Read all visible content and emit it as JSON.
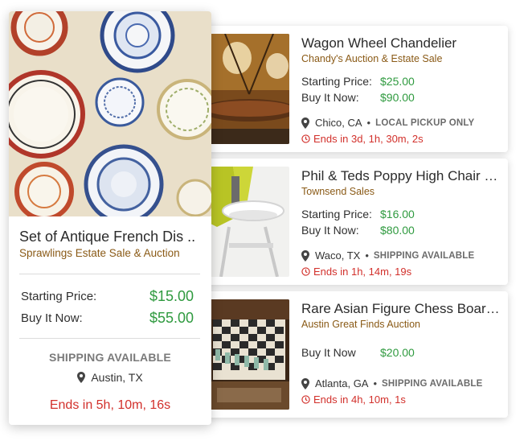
{
  "featured": {
    "title": "Set of Antique French Dis ..",
    "seller": "Sprawlings Estate Sale & Auction",
    "starting_label": "Starting Price:",
    "starting_price": "$15.00",
    "buy_label": "Buy It Now:",
    "buy_price": "$55.00",
    "shipping": "SHIPPING AVAILABLE",
    "location": "Austin, TX",
    "ends": "Ends in 5h, 10m, 16s",
    "image": "wall-plates-photo"
  },
  "listings": [
    {
      "title": "Wagon Wheel Chandelier",
      "seller": "Chandy's Auction & Estate Sale",
      "starting_label": "Starting Price:",
      "starting_price": "$25.00",
      "buy_label": "Buy It Now:",
      "buy_price": "$90.00",
      "location": "Chico, CA",
      "shipping": "LOCAL PICKUP ONLY",
      "ends": "Ends in 3d, 1h, 30m, 2s",
      "image": "chandelier-photo"
    },
    {
      "title": "Phil & Teds Poppy High Chair N...",
      "seller": "Townsend Sales",
      "starting_label": "Starting Price:",
      "starting_price": "$16.00",
      "buy_label": "Buy It Now:",
      "buy_price": "$80.00",
      "location": "Waco, TX",
      "shipping": "SHIPPING AVAILABLE",
      "ends": "Ends in 1h, 14m, 19s",
      "image": "high-chair-photo"
    },
    {
      "title": "Rare Asian Figure Chess Board...",
      "seller": "Austin Great Finds Auction",
      "buy_label": "Buy It Now",
      "buy_price": "$20.00",
      "location": "Atlanta, GA",
      "shipping": "SHIPPING AVAILABLE",
      "ends": "Ends in 4h, 10m, 1s",
      "image": "chess-board-photo"
    }
  ],
  "colors": {
    "price_green": "#2f9a3f",
    "seller_brown": "#8a5a16",
    "ends_red": "#d2302b"
  },
  "icons": [
    "location-pin-icon",
    "clock-icon"
  ]
}
